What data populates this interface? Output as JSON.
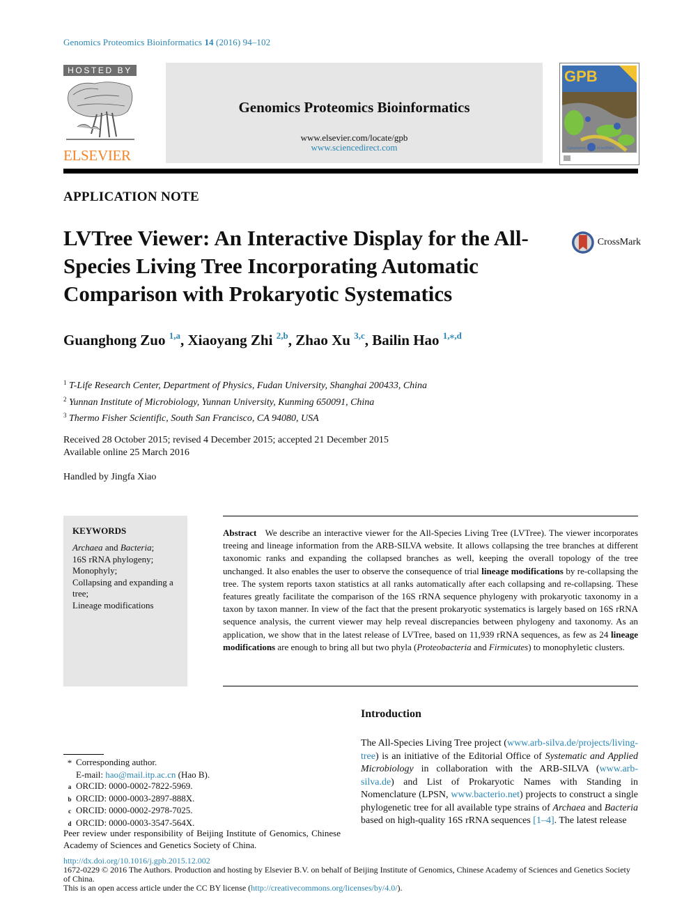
{
  "running_head": {
    "journal": "Genomics Proteomics Bioinformatics",
    "volume": "14",
    "year_pages": "(2016) 94–102"
  },
  "masthead": {
    "hosted_by": "HOSTED BY",
    "publisher": "ELSEVIER",
    "journal_name": "Genomics Proteomics Bioinformatics",
    "url_locate": "www.elsevier.com/locate/gpb",
    "url_sciencedirect": "www.sciencedirect.com",
    "cover": {
      "logo": "GPB",
      "caption": "Cytoplasmic Roles of lncRNAs"
    }
  },
  "article": {
    "type": "APPLICATION NOTE",
    "title": "LVTree Viewer: An Interactive Display for the All-Species Living Tree Incorporating Automatic Comparison with Prokaryotic Systematics",
    "crossmark": "CrossMark",
    "authors": [
      {
        "name": "Guanghong Zuo",
        "sup": "1,a"
      },
      {
        "name": "Xiaoyang Zhi",
        "sup": "2,b"
      },
      {
        "name": "Zhao Xu",
        "sup": "3,c"
      },
      {
        "name": "Bailin Hao",
        "sup": "1,⁎,d"
      }
    ],
    "affiliations": [
      {
        "num": "1",
        "text": "T-Life Research Center, Department of Physics, Fudan University, Shanghai 200433, China"
      },
      {
        "num": "2",
        "text": "Yunnan Institute of Microbiology, Yunnan University, Kunming 650091, China"
      },
      {
        "num": "3",
        "text": "Thermo Fisher Scientific, South San Francisco, CA 94080, USA"
      }
    ],
    "dates": {
      "history": "Received 28 October 2015; revised 4 December 2015; accepted 21 December 2015",
      "online": "Available online 25 March 2016"
    },
    "handled_by": "Handled by Jingfa Xiao"
  },
  "keywords": {
    "title": "KEYWORDS",
    "items": [
      {
        "parts": [
          {
            "t": "Archaea",
            "i": true
          },
          {
            "t": " and "
          },
          {
            "t": "Bacteria",
            "i": true
          },
          {
            "t": ";"
          }
        ]
      },
      {
        "parts": [
          {
            "t": "16S rRNA phylogeny;"
          }
        ]
      },
      {
        "parts": [
          {
            "t": "Monophyly;"
          }
        ]
      },
      {
        "parts": [
          {
            "t": "Collapsing and expanding a tree;"
          }
        ]
      },
      {
        "parts": [
          {
            "t": "Lineage modifications"
          }
        ]
      }
    ]
  },
  "abstract": {
    "label": "Abstract",
    "parts": [
      {
        "t": "We describe an interactive viewer for the All-Species Living Tree (LVTree). The viewer incorporates treeing and lineage information from the ARB-SILVA website. It allows collapsing the tree branches at different taxonomic ranks and expanding the collapsed branches as well, keeping the overall topology of the tree unchanged. It also enables the user to observe the consequence of trial "
      },
      {
        "t": "lineage modifications",
        "b": true
      },
      {
        "t": " by re-collapsing the tree. The system reports taxon statistics at all ranks automatically after each collapsing and re-collapsing. These features greatly facilitate the comparison of the 16S rRNA sequence phylogeny with prokaryotic taxonomy in a taxon by taxon manner. In view of the fact that the present prokaryotic systematics is largely based on 16S rRNA sequence analysis, the current viewer may help reveal discrepancies between phylogeny and taxonomy. As an application, we show that in the latest release of LVTree, based on 11,939 rRNA sequences, as few as 24 "
      },
      {
        "t": "lineage modifications",
        "b": true
      },
      {
        "t": " are enough to bring all but two phyla ("
      },
      {
        "t": "Proteobacteria",
        "i": true
      },
      {
        "t": " and "
      },
      {
        "t": "Firmicutes",
        "i": true
      },
      {
        "t": ") to monophyletic clusters."
      }
    ]
  },
  "introduction": {
    "heading": "Introduction",
    "parts": [
      {
        "t": "The All-Species Living Tree project ("
      },
      {
        "t": "www.arb-silva.de/projects/living-tree",
        "link": true
      },
      {
        "t": ") is an initiative of the Editorial Office of "
      },
      {
        "t": "Systematic and Applied Microbiology",
        "i": true
      },
      {
        "t": " in collaboration with the ARB-SILVA ("
      },
      {
        "t": "www.arb-silva.de",
        "link": true
      },
      {
        "t": ") and List of Prokaryotic Names with Standing in Nomenclature (LPSN, "
      },
      {
        "t": "www.bacterio.net",
        "link": true
      },
      {
        "t": ") projects to construct a single phylogenetic tree for all available type strains of "
      },
      {
        "t": "Archaea",
        "i": true
      },
      {
        "t": " and "
      },
      {
        "t": "Bacteria",
        "i": true
      },
      {
        "t": " based on high-quality 16S rRNA sequences "
      },
      {
        "t": "[1–4]",
        "link": true
      },
      {
        "t": ". The latest release"
      }
    ]
  },
  "footnotes": {
    "corresponding": {
      "mark": "*",
      "text": "Corresponding author."
    },
    "email": {
      "label": "E-mail: ",
      "address": "hao@mail.itp.ac.cn",
      "suffix": " (Hao B)."
    },
    "orcids": [
      {
        "mark": "a",
        "text": "ORCID: 0000-0002-7822-5969."
      },
      {
        "mark": "b",
        "text": "ORCID: 0000-0003-2897-888X."
      },
      {
        "mark": "c",
        "text": "ORCID: 0000-0002-2978-7025."
      },
      {
        "mark": "d",
        "text": "ORCID: 0000-0003-3547-564X."
      }
    ],
    "peer_review": "Peer review under responsibility of Beijing Institute of Genomics, Chinese Academy of Sciences and Genetics Society of China."
  },
  "bottom": {
    "doi": "http://dx.doi.org/10.1016/j.gpb.2015.12.002",
    "copyright": "1672-0229 © 2016 The Authors. Production and hosting by Elsevier B.V. on behalf of Beijing Institute of Genomics, Chinese Academy of Sciences and Genetics Society of China.",
    "license_prefix": "This is an open access article under the CC BY license (",
    "license_url": "http://creativecommons.org/licenses/by/4.0/",
    "license_suffix": ")."
  },
  "colors": {
    "link": "#2a86b5",
    "elsevier_orange": "#f0862a",
    "masthead_gray": "#e6e6e6",
    "hosted_by_gray": "#6e6e6e"
  }
}
